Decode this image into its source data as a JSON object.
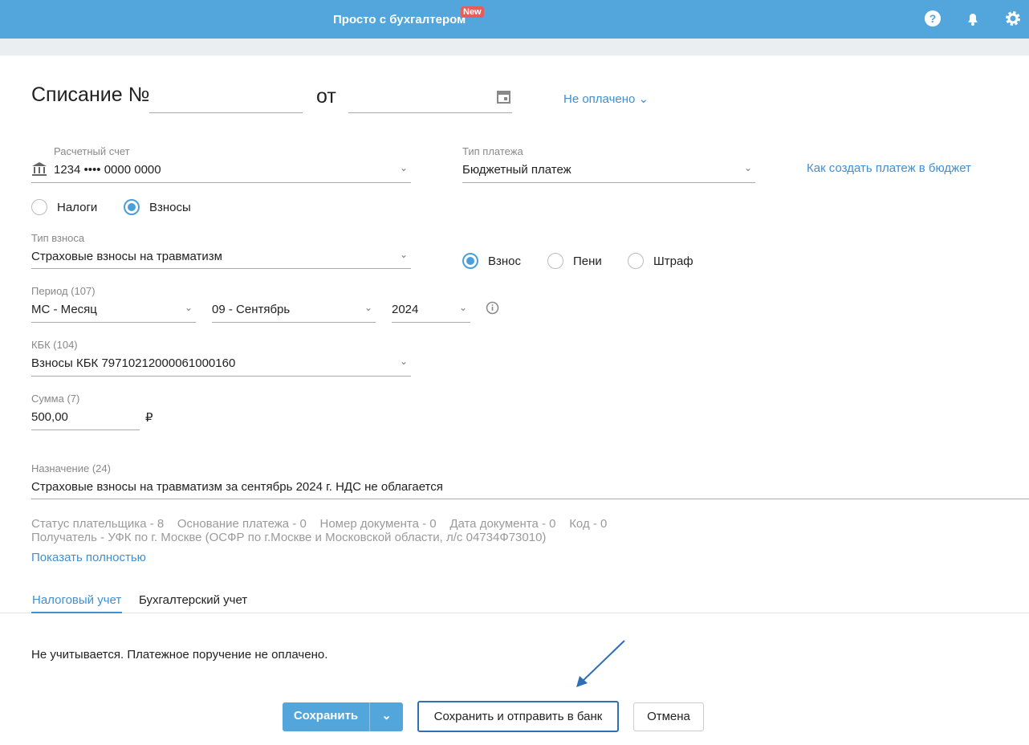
{
  "header": {
    "brand": "Просто с бухгалтером",
    "badge": "New"
  },
  "doc": {
    "title": "Списание №",
    "number": "",
    "from_label": "от",
    "date": "",
    "status": "Не оплачено"
  },
  "account": {
    "label": "Расчетный счет",
    "value": "1234 •••• 0000 0000"
  },
  "payment_type": {
    "label": "Тип платежа",
    "value": "Бюджетный платеж",
    "help_link": "Как создать платеж в бюджет"
  },
  "category": {
    "options": [
      "Налоги",
      "Взносы"
    ],
    "selected": "Взносы"
  },
  "contribution_type": {
    "label": "Тип взноса",
    "value": "Страховые взносы на травматизм"
  },
  "kind": {
    "options": [
      "Взнос",
      "Пени",
      "Штраф"
    ],
    "selected": "Взнос"
  },
  "period": {
    "label": "Период (107)",
    "type": "МС - Месяц",
    "month": "09 - Сентябрь",
    "year": "2024"
  },
  "kbk": {
    "label": "КБК (104)",
    "value": "Взносы КБК 79710212000061000160"
  },
  "sum": {
    "label": "Сумма (7)",
    "value": "500,00",
    "currency": "₽"
  },
  "purpose": {
    "label": "Назначение (24)",
    "value": "Страховые взносы на травматизм за сентябрь 2024 г. НДС не облагается"
  },
  "details": {
    "payer_status": "Статус плательщика - 8",
    "basis": "Основание платежа - 0",
    "doc_number": "Номер документа - 0",
    "doc_date": "Дата документа - 0",
    "code": "Код - 0",
    "recipient": "Получатель - УФК по г. Москве (ОСФР по г.Москве и Московской области, л/с 04734Ф73010)",
    "show_full": "Показать полностью"
  },
  "tabs": [
    {
      "label": "Налоговый учет",
      "active": true
    },
    {
      "label": "Бухгалтерский учет",
      "active": false
    }
  ],
  "tab_content": "Не учитывается. Платежное поручение не оплачено.",
  "buttons": {
    "save": "Сохранить",
    "save_send": "Сохранить и отправить в банк",
    "cancel": "Отмена"
  }
}
